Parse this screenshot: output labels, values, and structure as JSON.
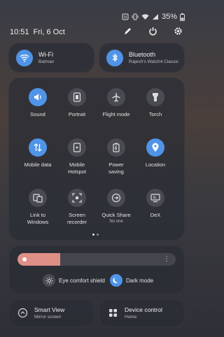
{
  "status_bar": {
    "battery": "35%",
    "icons": [
      "nfc-icon",
      "vibrate-icon",
      "wifi-icon",
      "signal-icon",
      "battery-icon"
    ]
  },
  "header": {
    "time": "10:51",
    "date": "Fri, 6 Oct",
    "actions": [
      "edit-icon",
      "power-icon",
      "settings-icon"
    ]
  },
  "connections": {
    "wifi": {
      "title": "Wi-Fi",
      "subtitle": "Batman"
    },
    "bluetooth": {
      "title": "Bluetooth",
      "subtitle": "Rajesh's Watch4 Classic"
    }
  },
  "tiles": [
    {
      "label": "Sound",
      "icon": "sound-icon",
      "active": true
    },
    {
      "label": "Portrait",
      "icon": "portrait-icon",
      "active": false
    },
    {
      "label": "Flight mode",
      "icon": "airplane-icon",
      "active": false
    },
    {
      "label": "Torch",
      "icon": "torch-icon",
      "active": false
    },
    {
      "label": "Mobile data",
      "icon": "mobile-data-icon",
      "active": true
    },
    {
      "label": "Mobile Hotspot",
      "icon": "hotspot-icon",
      "active": false
    },
    {
      "label": "Power saving",
      "icon": "battery-saver-icon",
      "active": false
    },
    {
      "label": "Location",
      "icon": "location-icon",
      "active": true
    },
    {
      "label": "Link to Windows",
      "icon": "link-windows-icon",
      "active": false
    },
    {
      "label": "Screen recorder",
      "icon": "screen-recorder-icon",
      "active": false
    },
    {
      "label": "Quick Share",
      "sublabel": "No one",
      "icon": "quick-share-icon",
      "active": false
    },
    {
      "label": "DeX",
      "icon": "dex-icon",
      "active": false
    }
  ],
  "page_indicator": {
    "pages": 2,
    "current": 1
  },
  "brightness": {
    "level": 0.27,
    "accent": "#e08f86"
  },
  "display_modes": {
    "eye_comfort": {
      "label": "Eye comfort shield",
      "active": false
    },
    "dark_mode": {
      "label": "Dark mode",
      "active": true
    }
  },
  "bottom": {
    "smart_view": {
      "title": "Smart View",
      "subtitle": "Mirror screen"
    },
    "device_control": {
      "title": "Device control",
      "subtitle": "Home"
    }
  },
  "colors": {
    "accent": "#4f94e8",
    "tile_off": "#4a4b52"
  }
}
